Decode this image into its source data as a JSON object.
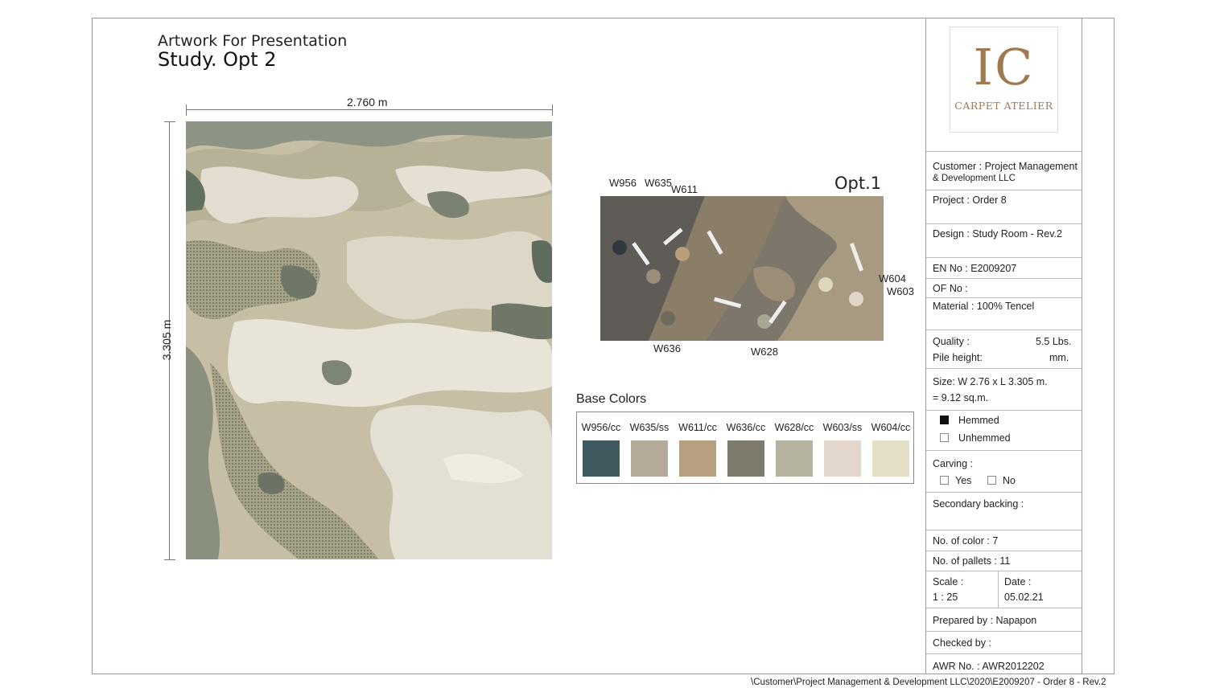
{
  "header": {
    "heading": "Artwork For Presentation",
    "subheading": "Study. Opt 2"
  },
  "dimensions": {
    "width": "2.760 m",
    "length": "3.305 m"
  },
  "sample": {
    "label": "Opt.1",
    "tags": [
      "W956",
      "W635",
      "W611",
      "W604",
      "W603",
      "W636",
      "W628"
    ]
  },
  "base_colors": {
    "title": "Base Colors",
    "items": [
      {
        "code": "W956/cc",
        "color": "#3e5a5e"
      },
      {
        "code": "W635/ss",
        "color": "#b4aa9a"
      },
      {
        "code": "W611/cc",
        "color": "#b5a080"
      },
      {
        "code": "W636/cc",
        "color": "#7e7a6c"
      },
      {
        "code": "W628/cc",
        "color": "#b5b3a0"
      },
      {
        "code": "W603/ss",
        "color": "#e3d7cd"
      },
      {
        "code": "W604/cc",
        "color": "#e6dfc8"
      }
    ]
  },
  "brand": {
    "mark": "IC",
    "name": "CARPET ATELIER",
    "accent": "#9d7a52"
  },
  "info": {
    "customer_line1": "Customer : Project Management",
    "customer_line2": "& Development LLC",
    "project": "Project : Order 8",
    "design": "Design : Study Room - Rev.2",
    "en_no": "EN No : E2009207",
    "of_no": "OF No :",
    "material": "Material : 100% Tencel",
    "quality_label": "Quality :",
    "quality_value": "5.5 Lbs.",
    "pile_label": "Pile height:",
    "pile_value": "mm.",
    "size_line1": "Size: W  2.76 x L 3.305 m.",
    "size_line2": "= 9.12 sq.m.",
    "hemmed": "Hemmed",
    "unhemmed": "Unhemmed",
    "carving_label": "Carving :",
    "carving_yes": "Yes",
    "carving_no": "No",
    "secondary_backing": "Secondary backing :",
    "no_of_color": "No. of color :  7",
    "no_of_pallets": "No. of pallets : 11",
    "scale_label": "Scale :",
    "scale_value": "1 : 25",
    "date_label": "Date :",
    "date_value": "05.02.21",
    "prepared_by": "Prepared by : Napapon",
    "checked_by": "Checked by :",
    "awr_no": "AWR No. : AWR2012202"
  },
  "footer": {
    "path": "\\Customer\\Project Management & Development LLC\\2020\\E2009207 - Order 8 - Rev.2"
  }
}
